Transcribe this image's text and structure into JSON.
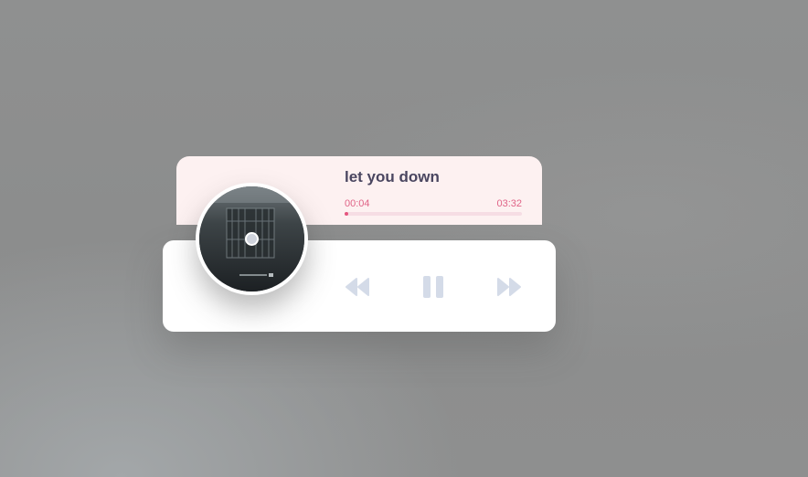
{
  "track": {
    "title": "let you down",
    "current_time": "00:04",
    "total_time": "03:32",
    "progress": 0.019
  },
  "controls": {
    "previous_icon": "rewind-icon",
    "pause_icon": "pause-icon",
    "next_icon": "fast-forward-icon"
  },
  "colors": {
    "accent": "#e5557e",
    "title": "#4a4660",
    "control_icons": "#d4dbe8",
    "info_card_bg": "#fdf1f1"
  }
}
